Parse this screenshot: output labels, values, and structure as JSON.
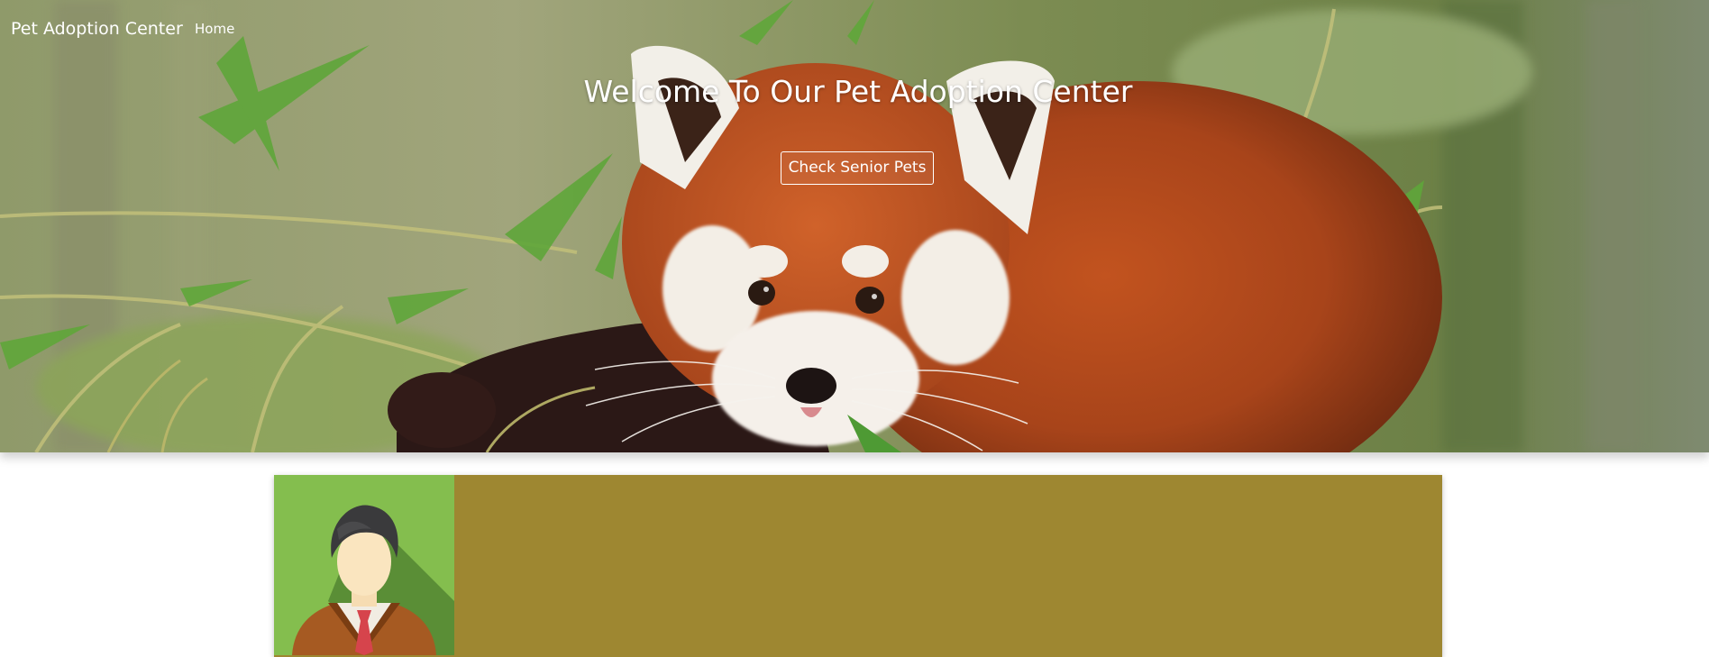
{
  "navbar": {
    "brand": "Pet Adoption Center",
    "links": [
      {
        "label": "Home"
      }
    ]
  },
  "hero": {
    "title": "Welcome To Our Pet Adoption Center",
    "button_label": "Check Senior Pets",
    "background_image": "red-panda-among-bamboo"
  },
  "profile_card": {
    "avatar_icon": "user-avatar-icon"
  },
  "colors": {
    "card_background": "#9e8731",
    "avatar_background": "#84be4e",
    "hero_text": "#ffffff"
  }
}
